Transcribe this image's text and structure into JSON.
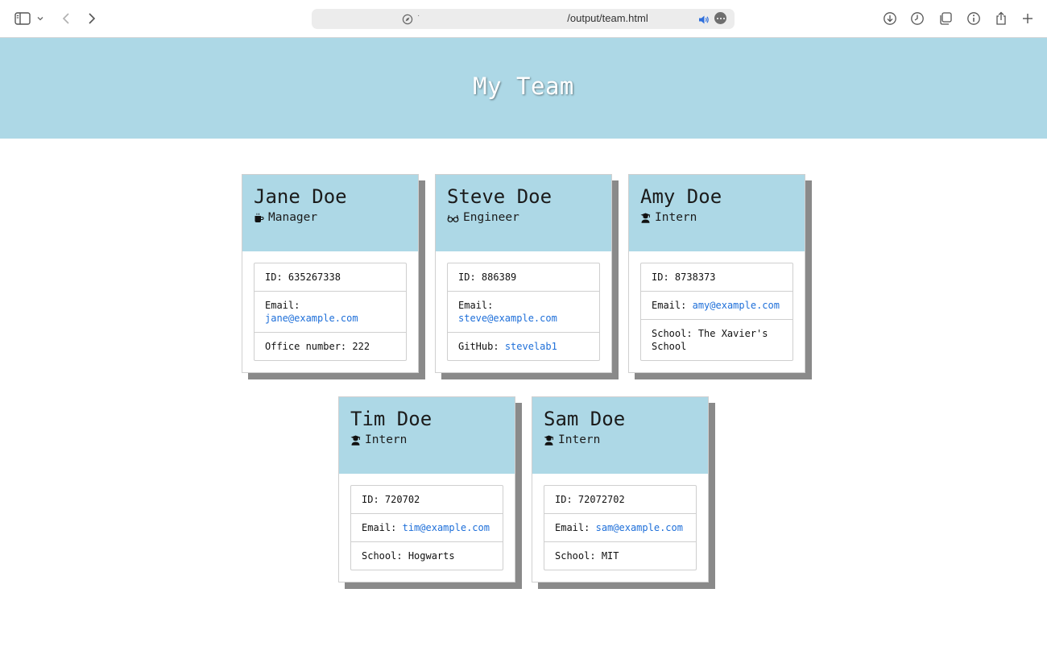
{
  "browser": {
    "url": "/output/team.html"
  },
  "header": {
    "title": "My Team"
  },
  "employees": [
    {
      "name": "Jane Doe",
      "role": "Manager",
      "role_icon": "mug-icon",
      "id_label": "ID:",
      "id": "635267338",
      "email_label": "Email:",
      "email": "jane@example.com",
      "extra_label": "Office number:",
      "extra": "222"
    },
    {
      "name": "Steve Doe",
      "role": "Engineer",
      "role_icon": "glasses-icon",
      "id_label": "ID:",
      "id": "886389",
      "email_label": "Email:",
      "email": "steve@example.com",
      "extra_label": "GitHub:",
      "extra": "stevelab1"
    },
    {
      "name": "Amy Doe",
      "role": "Intern",
      "role_icon": "graduate-icon",
      "id_label": "ID:",
      "id": "8738373",
      "email_label": "Email:",
      "email": "amy@example.com",
      "extra_label": "School:",
      "extra": "The Xavier's School"
    },
    {
      "name": "Tim Doe",
      "role": "Intern",
      "role_icon": "graduate-icon",
      "id_label": "ID:",
      "id": "720702",
      "email_label": "Email:",
      "email": "tim@example.com",
      "extra_label": "School:",
      "extra": "Hogwarts"
    },
    {
      "name": "Sam Doe",
      "role": "Intern",
      "role_icon": "graduate-icon",
      "id_label": "ID:",
      "id": "72072702",
      "email_label": "Email:",
      "email": "sam@example.com",
      "extra_label": "School:",
      "extra": "MIT"
    }
  ],
  "colors": {
    "banner": "#add8e6",
    "link": "#1e6fd9",
    "card_shadow": "#8a8a8a"
  }
}
